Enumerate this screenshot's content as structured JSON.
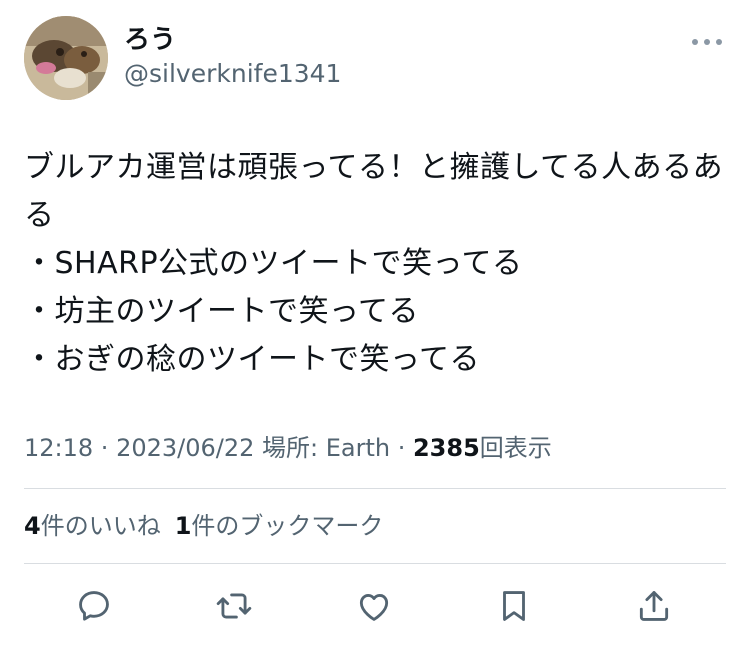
{
  "tweet": {
    "author": {
      "display_name": "ろう",
      "handle": "@silverknife1341",
      "avatar_icon": "avatar-image"
    },
    "more_icon": "more-horizontal-icon",
    "body": "ブルアカ運営は頑張ってる！と擁護してる人あるある\n・SHARP公式のツイートで笑ってる\n・坊主のツイートで笑ってる\n・おぎの稔のツイートで笑ってる",
    "meta": {
      "time": "12:18",
      "sep1": " · ",
      "date": "2023/06/22",
      "location": " 場所: Earth",
      "sep2": " · ",
      "views_count": "2385",
      "views_label": "回表示"
    },
    "engagement": {
      "likes_count": "4",
      "likes_label": "件のいいね",
      "bookmarks_count": "1",
      "bookmarks_label": "件のブックマーク"
    },
    "actions": [
      {
        "name": "reply-icon"
      },
      {
        "name": "retweet-icon"
      },
      {
        "name": "like-icon"
      },
      {
        "name": "bookmark-icon"
      },
      {
        "name": "share-icon"
      }
    ],
    "colors": {
      "text_primary": "#0f1419",
      "text_secondary": "#536471",
      "divider": "#d9dde1"
    }
  }
}
